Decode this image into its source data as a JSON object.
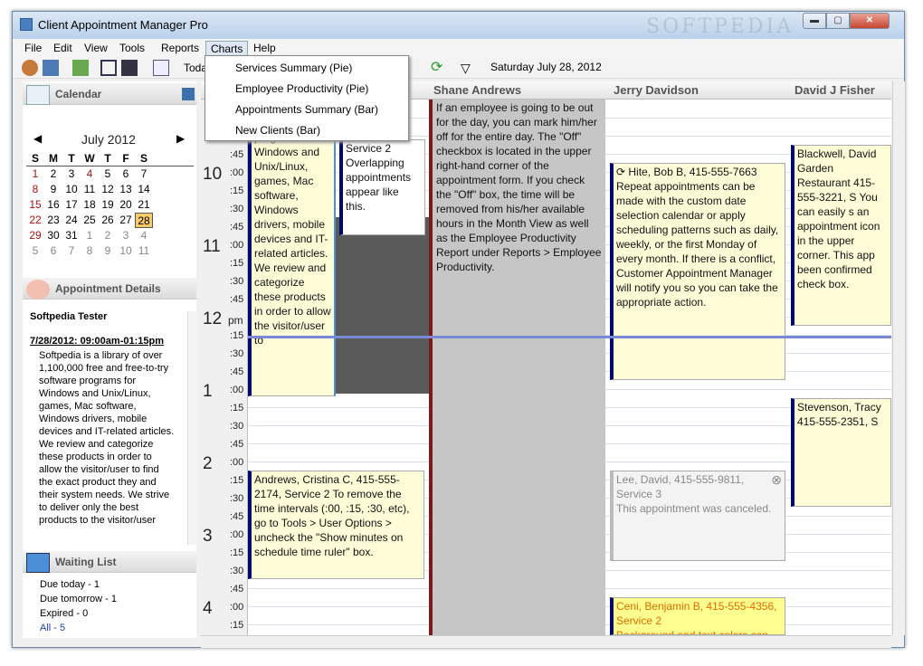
{
  "window": {
    "title": "Client Appointment Manager Pro",
    "watermark": "SOFTPEDIA",
    "min": "▬",
    "max": "▢",
    "close": "✕"
  },
  "menu": [
    "File",
    "Edit",
    "View",
    "Tools",
    "Reports",
    "Charts",
    "Help"
  ],
  "charts_menu": [
    "Services Summary (Pie)",
    "Employee Productivity (Pie)",
    "Appointments Summary (Bar)",
    "New Clients (Bar)"
  ],
  "toolbar": {
    "today": "Toda",
    "date": "Saturday July 28, 2012"
  },
  "calendar": {
    "header": "Calendar",
    "month": "July 2012",
    "prev": "◀",
    "next": "▶",
    "dow": [
      "S",
      "M",
      "T",
      "W",
      "T",
      "F",
      "S"
    ],
    "weeks": [
      [
        "1",
        "2",
        "3",
        "4",
        "5",
        "6",
        "7"
      ],
      [
        "8",
        "9",
        "10",
        "11",
        "12",
        "13",
        "14"
      ],
      [
        "15",
        "16",
        "17",
        "18",
        "19",
        "20",
        "21"
      ],
      [
        "22",
        "23",
        "24",
        "25",
        "26",
        "27",
        "28"
      ],
      [
        "29",
        "30",
        "31",
        "1",
        "2",
        "3",
        "4"
      ],
      [
        "5",
        "6",
        "7",
        "8",
        "9",
        "10",
        "11"
      ]
    ]
  },
  "appt_details": {
    "header": "Appointment Details",
    "owner": "Softpedia Tester",
    "date": "7/28/2012: 09:00am-01:15pm",
    "body": "Softpedia is a library of over 1,100,000 free and free-to-try software programs for Windows and Unix/Linux, games, Mac software, Windows drivers, mobile devices and IT-related articles. We review and categorize these products in order to allow the visitor/user to find the exact product they and their system needs. We strive to deliver only the best products to the visitor/user"
  },
  "waiting": {
    "header": "Waiting List",
    "items": [
      "Due today - 1",
      "Due tomorrow - 1",
      "Expired - 0",
      "All - 5"
    ]
  },
  "columns": [
    "Shane Andrews",
    "Jerry Davidson",
    "David J Fisher"
  ],
  "ruler": {
    "hours": [
      "10",
      "11",
      "12",
      "1",
      "2",
      "3",
      "4"
    ],
    "pm": "pm",
    "minutes": [
      ":00",
      ":15",
      ":30",
      ":45"
    ]
  },
  "appts": {
    "a1": "and free-to-try software programs for Windows and Unix/Linux, games, Mac software, Windows drivers, mobile devices and IT-related articles. We review and categorize these products in order to allow the visitor/user to",
    "a2": "Service 2 Overlapping appointments appear like this.",
    "a3": "If an employee is going to be out for the day, you can mark him/her off for the entire day. The \"Off\" checkbox is located in the upper right-hand corner of the appointment form. If you check the \"Off\" box, the time will be removed from his/her available hours in the Month View as well as the Employee Productivity Report under Reports > Employee Productivity.",
    "a4t": "Hite, Bob B, 415-555-7663",
    "a4": "Repeat appointments can be made with the custom date selection calendar or apply scheduling patterns such as daily, weekly, or the first Monday of every month. If there is a conflict, Customer Appointment Manager will notify you so you can take the appropriate action.",
    "a5": "Blackwell, David Garden Restaurant 415-555-3221, S You can easily s an appointment icon in the upper corner. This app been confirmed check box.",
    "a6": "Stevenson, Tracy 415-555-2351, S",
    "a7": "Andrews, Cristina C, 415-555-2174, Service 2 To remove the time intervals (:00, :15, :30, etc), go to Tools > User Options > uncheck the \"Show minutes on schedule time ruler\" box.",
    "a8": "Lee, David, 415-555-9811, Service 3",
    "a8b": "This appointment was canceled.",
    "a9": "Ceni, Benjamin B, 415-555-4356, Service 2",
    "a9b": "Background and text colors can"
  }
}
